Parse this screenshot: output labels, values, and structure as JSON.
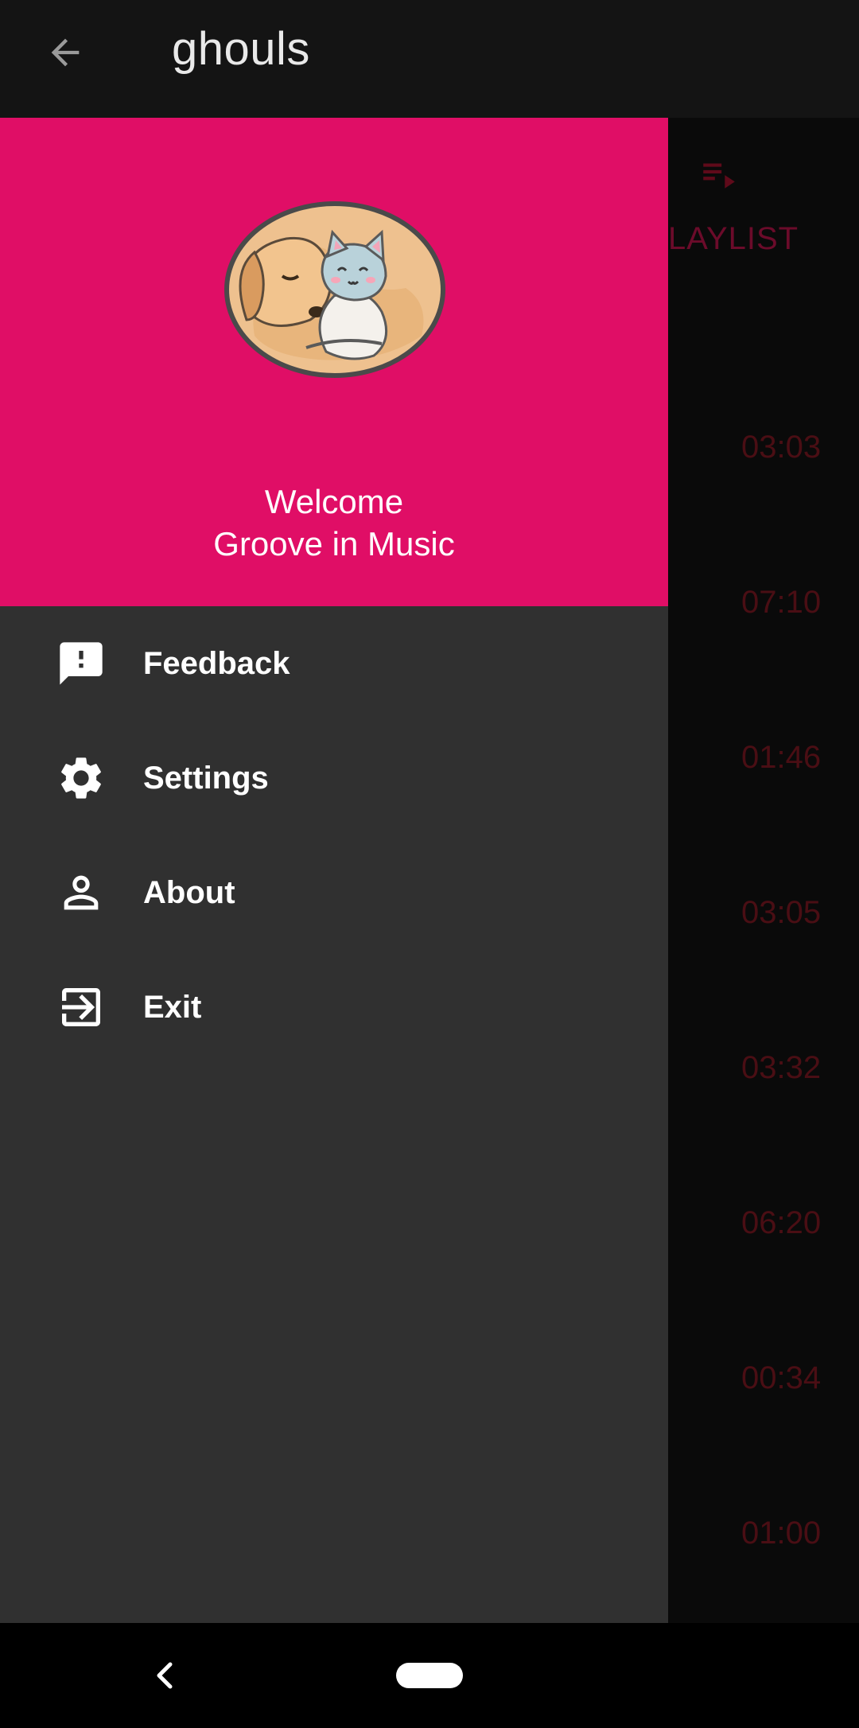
{
  "appbar": {
    "title": "ghouls",
    "back_icon": "arrow-back-icon"
  },
  "background": {
    "tab_icon": "playlist-play-icon",
    "tab_label": "LAYLIST",
    "durations": [
      "03:03",
      "07:10",
      "01:46",
      "03:05",
      "03:32",
      "06:20",
      "00:34",
      "01:00"
    ]
  },
  "drawer": {
    "header_color": "#e00e66",
    "avatar": "dog-and-cat-avatar",
    "welcome_line1": "Welcome",
    "welcome_line2": "Groove in Music",
    "menu": [
      {
        "label": "Feedback",
        "icon": "feedback-icon"
      },
      {
        "label": "Settings",
        "icon": "gear-icon"
      },
      {
        "label": "About",
        "icon": "person-icon"
      },
      {
        "label": "Exit",
        "icon": "exit-icon"
      }
    ]
  },
  "navbar": {
    "back_icon": "nav-back-icon",
    "home_icon": "home-pill-icon"
  }
}
